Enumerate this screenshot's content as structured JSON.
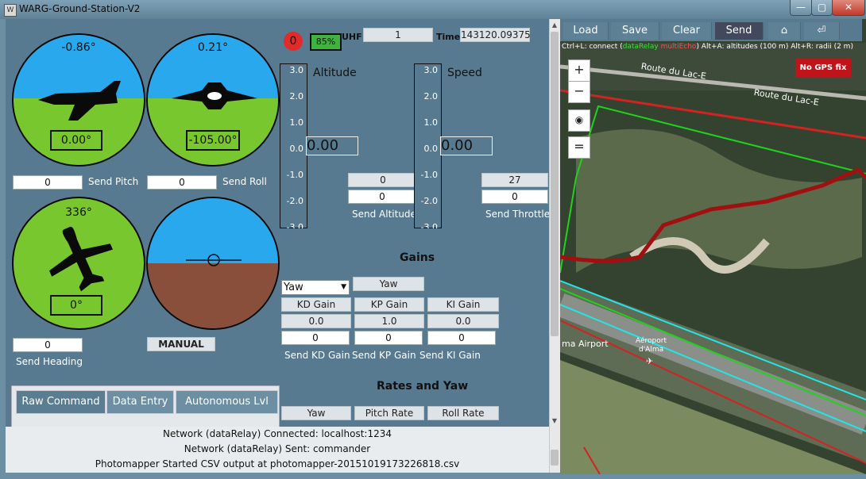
{
  "window": {
    "title": "WARG-Ground-Station-V2",
    "app_icon": "W",
    "min": "—",
    "max": "▢",
    "close": "✕"
  },
  "attitude": {
    "pitch": {
      "display": "-0.86°",
      "readout": "0.00°",
      "input": "0",
      "send_label": "Send Pitch"
    },
    "roll": {
      "display": "0.21°",
      "readout": "-105.00°",
      "input": "0",
      "send_label": "Send Roll"
    },
    "heading": {
      "display": "336°",
      "readout": "0°",
      "input": "0",
      "send_label": "Send Heading"
    },
    "horizon": {
      "mode_label": "MANUAL"
    }
  },
  "status": {
    "count": "0",
    "battery": "85%",
    "uhf_label": "UHF",
    "uhf_value": "1",
    "time_label": "Time",
    "time_value": "143120.09375"
  },
  "altitude": {
    "title": "Altitude",
    "ticks": [
      "3.0",
      "2.0",
      "1.0",
      "0.0",
      "-1.0",
      "-2.0",
      "-3.0"
    ],
    "value": "0.00",
    "setpoint": "0",
    "input": "0",
    "send_label": "Send Altitude"
  },
  "speed": {
    "title": "Speed",
    "ticks": [
      "3.0",
      "2.0",
      "1.0",
      "0.0",
      "-1.0",
      "-2.0",
      "-3.0"
    ],
    "value": "0.00",
    "setpoint": "27",
    "input": "0",
    "send_label": "Send Throttle"
  },
  "gains": {
    "title": "Gains",
    "select_value": "Yaw",
    "selected_label": "Yaw",
    "kd": {
      "label": "KD Gain",
      "value": "0.0",
      "input": "0",
      "send_label": "Send KD Gain"
    },
    "kp": {
      "label": "KP Gain",
      "value": "1.0",
      "input": "0",
      "send_label": "Send KP Gain"
    },
    "ki": {
      "label": "KI Gain",
      "value": "0.0",
      "input": "0",
      "send_label": "Send KI Gain"
    }
  },
  "rates": {
    "title": "Rates and Yaw",
    "yaw_label": "Yaw",
    "pitch_rate_label": "Pitch Rate",
    "roll_rate_label": "Roll Rate"
  },
  "tabs": [
    "Raw Command",
    "Data Entry",
    "Autonomous Lvl"
  ],
  "log": [
    "Network (dataRelay) Connected: localhost:1234",
    "Network (dataRelay) Sent: commander",
    "Photomapper Started CSV output at photomapper-20151019173226818.csv"
  ],
  "map": {
    "toolbar": [
      "Load",
      "Save",
      "Clear",
      "Send"
    ],
    "home_icon": "⌂",
    "return_icon": "⏎",
    "hint_a": "Ctrl+L: connect (",
    "hint_b": "dataRelay",
    "hint_c": " multiEcho",
    "hint_d": ")     Alt+A: altitudes (100 m)     Alt+R: radii (2 m)",
    "no_gps": "No GPS fix",
    "road1": "Route du Lac-E",
    "road2": "Route du Lac-E",
    "airport": "ma Airport",
    "airport2a": "Aéroport",
    "airport2b": "d'Alma",
    "zoom_in": "+",
    "zoom_out": "−",
    "locate": "◉",
    "layers": "="
  },
  "colors": {
    "sky": "#29a8ee",
    "ground": "#79c72e",
    "earth": "#8a4f3a",
    "panel": "#587a90",
    "alert": "#c0141b",
    "battery": "#3fb23f"
  }
}
